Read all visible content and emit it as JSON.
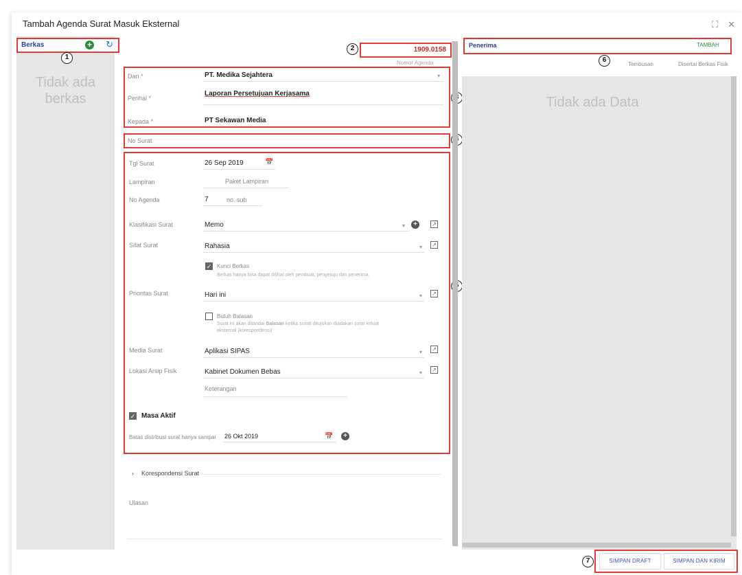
{
  "dialog": {
    "title": "Tambah Agenda Surat Masuk Eksternal",
    "expand_icon": "expand-icon",
    "close_icon": "close-icon"
  },
  "left": {
    "title": "Berkas",
    "empty_text": "Tidak ada berkas",
    "add_icon": "plus-circle-icon",
    "refresh_icon": "refresh-icon"
  },
  "annotations": [
    "1",
    "2",
    "3",
    "4",
    "5",
    "6",
    "7"
  ],
  "agenda": {
    "number": "1909.0158",
    "hint": "Nomor Agenda"
  },
  "fields": {
    "dari": {
      "label": "Dari *",
      "value": "PT. Medika Sejahtera"
    },
    "perihal": {
      "label": "Perihal *",
      "value": "Laporan Persetujuan Kerjasama"
    },
    "kepada": {
      "label": "Kepada *",
      "value": "PT Sekawan Media"
    },
    "no_surat": {
      "placeholder": "No Surat"
    },
    "tgl_surat": {
      "label": "Tgl Surat",
      "value": "26 Sep 2019"
    },
    "lampiran": {
      "label": "Lampiran",
      "placeholder": "Paket Lampiran"
    },
    "no_agenda": {
      "label": "No Agenda",
      "value": "7",
      "placeholder": "no. sub"
    },
    "klasifikasi": {
      "label": "Klasifikasi Surat",
      "value": "Memo"
    },
    "sifat": {
      "label": "Sifat Surat",
      "value": "Rahasia"
    },
    "kunci_berkas": {
      "label": "Kunci Berkas",
      "hint": "Berkas hanya bisa dapat dilihat oleh pembuat, penyetuju dan penerima"
    },
    "prioritas": {
      "label": "Prioritas Surat",
      "value": "Hari ini"
    },
    "butuh_balasan": {
      "label": "Butuh Balasan",
      "hint1": "Surat ini akan ditandai",
      "hint_bold": "Balasan",
      "hint2": "ketika suratt ditujukan diadakan surat keluar",
      "hint3": "eksternal (korespondensi)"
    },
    "media": {
      "label": "Media Surat",
      "value": "Aplikasi SIPAS"
    },
    "lokasi": {
      "label": "Lokasi Arsip Fisik",
      "value": "Kabinet Dokumen Bebas"
    },
    "keterangan": {
      "placeholder": "Keterangan"
    },
    "masa_aktif": {
      "label": "Masa Aktif"
    },
    "batas": {
      "label": "Batas distribusi surat hanya sampai",
      "value": "26 Okt 2019"
    },
    "korespondensi": {
      "label": "Korespondensi Surat"
    },
    "ulasan": {
      "label": "Ulasan"
    }
  },
  "right": {
    "title": "Penerima",
    "add_label": "TAMBAH",
    "links": [
      "Tembusan",
      "Disertai Berkas Fisik"
    ],
    "empty_text": "Tidak ada Data"
  },
  "buttons": {
    "draft": "SIMPAN DRAFT",
    "send": "SIMPAN DAN KIRIM"
  },
  "colors": {
    "annotation_border": "#e53935",
    "accent_blue": "#3f51b5",
    "green": "#2e8b3e"
  }
}
